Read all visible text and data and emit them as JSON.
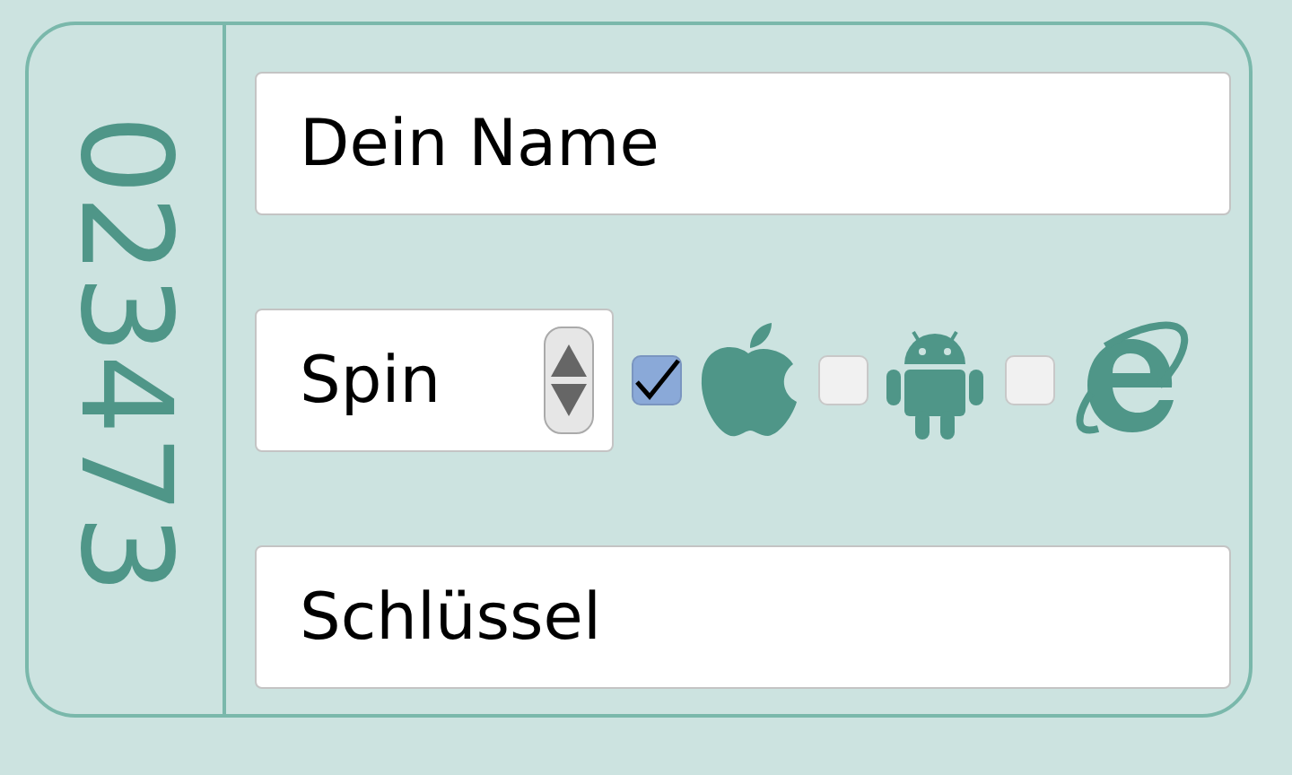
{
  "code": "023473",
  "name_field": {
    "value": "Dein Name"
  },
  "spin_field": {
    "value": "Spin"
  },
  "platforms": [
    {
      "kind": "apple",
      "checked": true
    },
    {
      "kind": "android",
      "checked": false
    },
    {
      "kind": "ie",
      "checked": false
    }
  ],
  "key_field": {
    "value": "Schlüssel"
  }
}
